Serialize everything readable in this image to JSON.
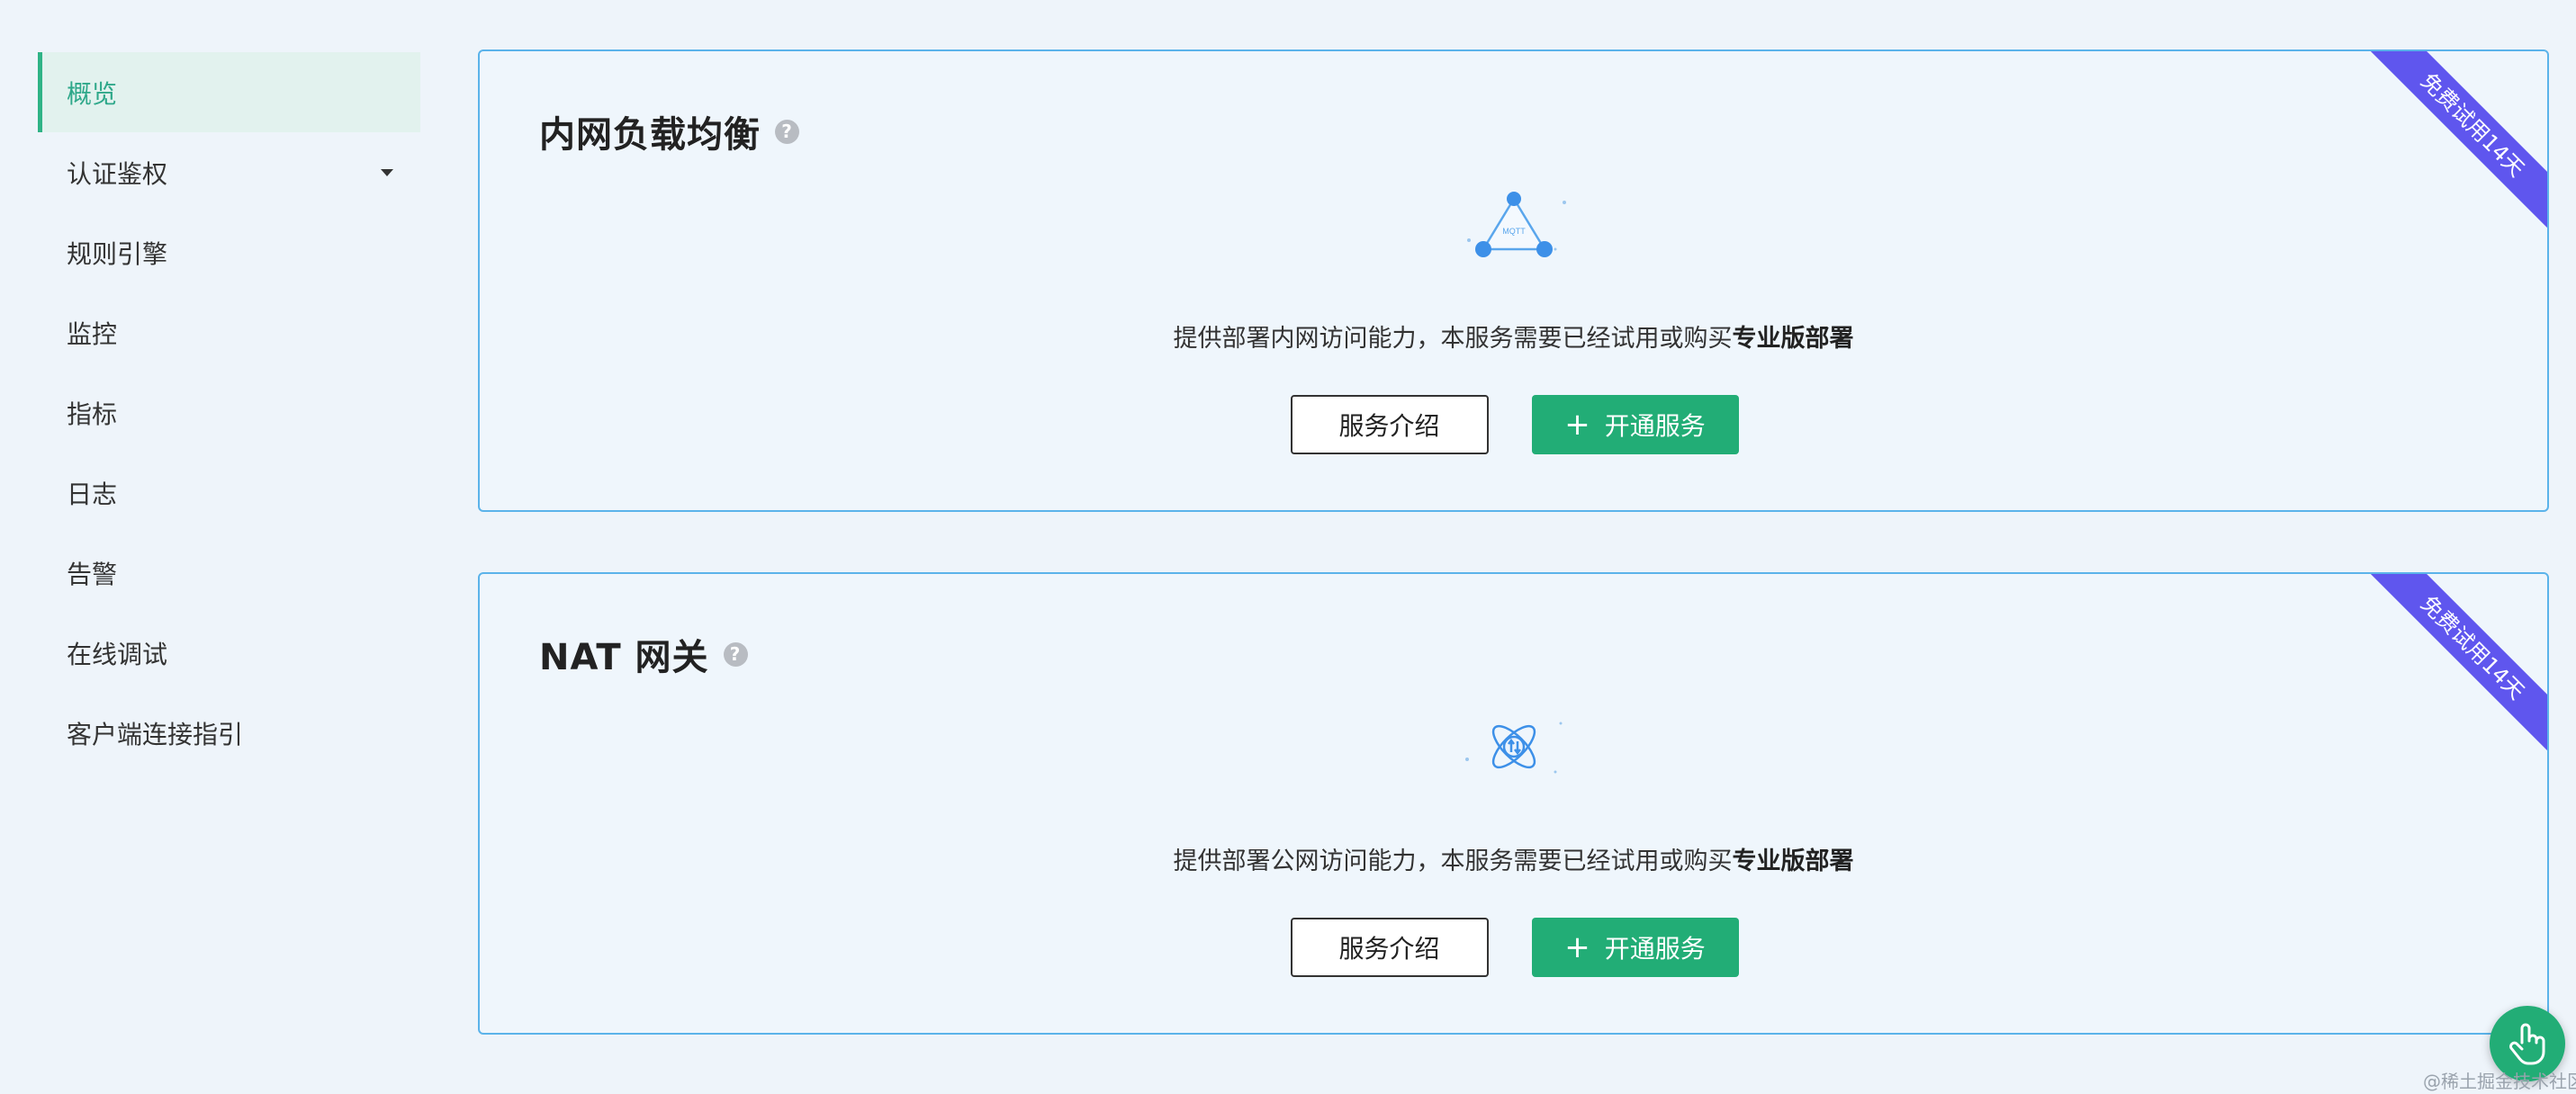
{
  "sidebar": {
    "items": [
      {
        "label": "概览",
        "active": true
      },
      {
        "label": "认证鉴权",
        "has_dropdown": true
      },
      {
        "label": "规则引擎"
      },
      {
        "label": "监控"
      },
      {
        "label": "指标"
      },
      {
        "label": "日志"
      },
      {
        "label": "告警"
      },
      {
        "label": "在线调试"
      },
      {
        "label": "客户端连接指引"
      }
    ]
  },
  "cards": [
    {
      "title": "内网负载均衡",
      "ribbon": "免费试用14天",
      "illustration_icon": "mqtt-network-icon",
      "illustration_text": "MQTT",
      "description": "提供部署内网访问能力，本服务需要已经试用或购买",
      "description_strong": "专业版部署",
      "intro_button": "服务介绍",
      "open_button_icon": "+",
      "open_button": "开通服务"
    },
    {
      "title": "NAT 网关",
      "ribbon": "免费试用14天",
      "illustration_icon": "nat-gateway-icon",
      "description": "提供部署公网访问能力，本服务需要已经试用或购买",
      "description_strong": "专业版部署",
      "intro_button": "服务介绍",
      "open_button_icon": "+",
      "open_button": "开通服务"
    }
  ],
  "help_icon_glyph": "?",
  "watermark": "@稀土掘金技术社区",
  "colors": {
    "accent": "#22ad76",
    "active_nav_text": "#2fa88a",
    "active_nav_bg": "#e2f2ee",
    "card_border": "#5bb3ea",
    "ribbon": "#5f56ee",
    "page_bg": "#eef4fa"
  }
}
